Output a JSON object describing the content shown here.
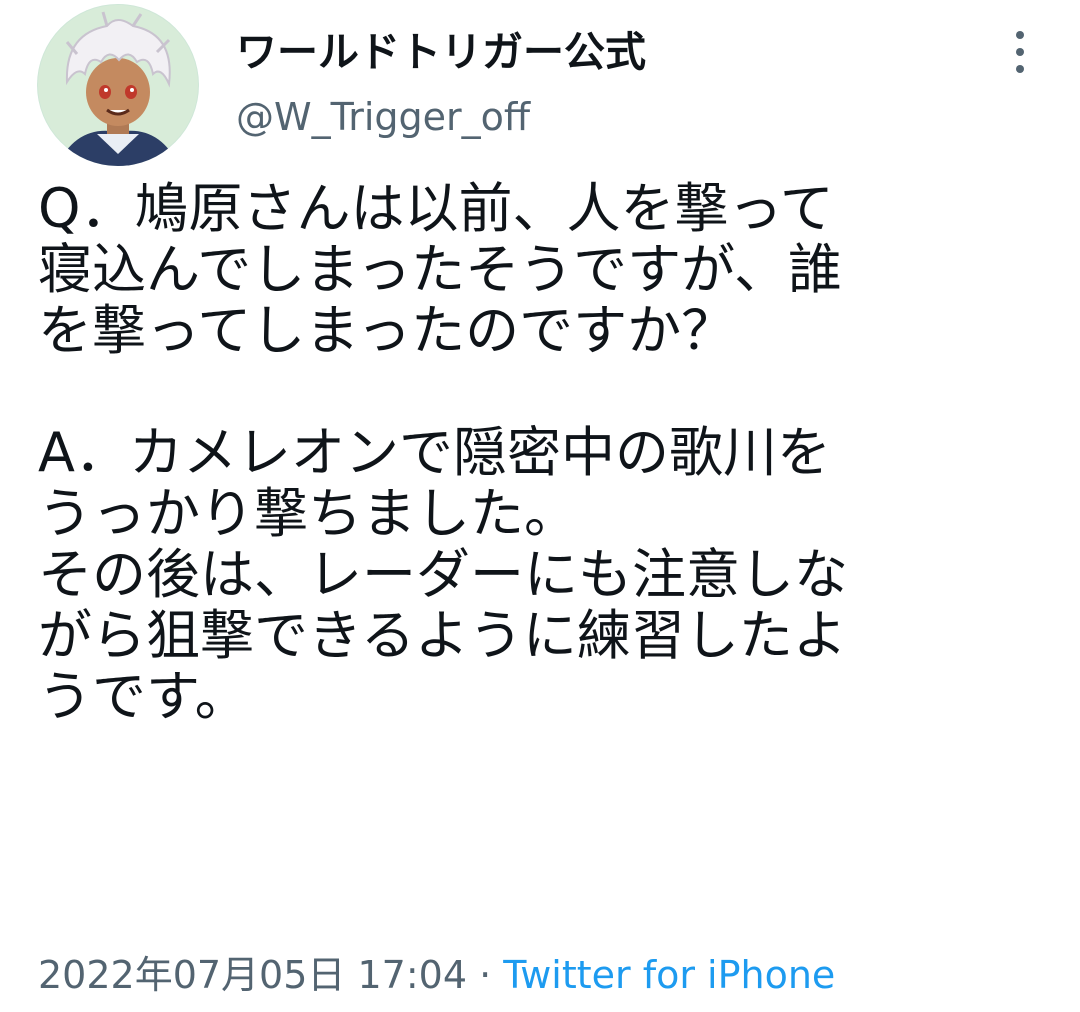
{
  "author": {
    "display_name": "ワールドトリガー公式",
    "handle": "@W_Trigger_off",
    "avatar_icon": "profile-avatar-anime-character"
  },
  "menu": {
    "icon": "more-vertical-icon"
  },
  "tweet": {
    "lines": [
      "Q．鳩原さんは以前、人を撃って",
      "寝込んでしまったそうですが、誰",
      "を撃ってしまったのですか？",
      "",
      "A．カメレオンで隠密中の歌川を",
      "うっかり撃ちました。",
      "その後は、レーダーにも注意しな",
      "がら狙撃できるように練習したよ",
      "うです。"
    ]
  },
  "meta": {
    "timestamp": "2022年07月05日 17:04",
    "separator": " · ",
    "source": "Twitter for iPhone"
  },
  "colors": {
    "text": "#0f1419",
    "secondary": "#536471",
    "link": "#1d9bf0"
  }
}
